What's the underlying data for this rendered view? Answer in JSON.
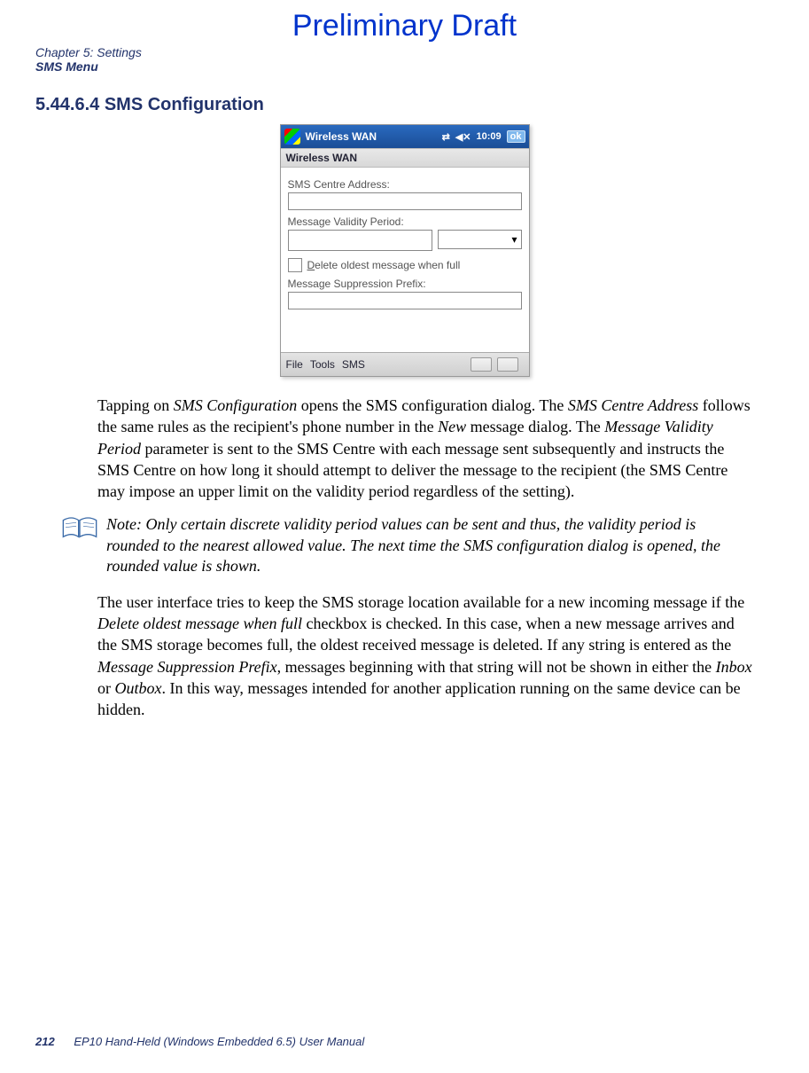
{
  "header": {
    "draft": "Preliminary Draft",
    "chapter": "Chapter 5: Settings",
    "section": "SMS Menu"
  },
  "heading": "5.44.6.4 SMS Configuration",
  "screenshot": {
    "titlebar": {
      "app": "Wireless WAN",
      "conn_icon": "connectivity-icon",
      "vol_icon": "volume-icon",
      "time": "10:09",
      "ok": "ok"
    },
    "subheader": "Wireless WAN",
    "labels": {
      "sms_centre": "SMS Centre Address:",
      "validity": "Message Validity Period:",
      "delete_prefix": "D",
      "delete_rest": "elete oldest message when full",
      "suppression": "Message Suppression Prefix:"
    },
    "menubar": {
      "file": "File",
      "tools": "Tools",
      "sms": "SMS"
    }
  },
  "para1": {
    "t1": "Tapping on ",
    "i1": "SMS Configuration",
    "t2": " opens the SMS configuration dialog. The ",
    "i2": "SMS Centre Address",
    "t3": " follows the same rules as the recipient's phone number in the ",
    "i3": "New",
    "t4": " message dialog. The ",
    "i4": "Message Validity Period",
    "t5": " parameter is sent to the SMS Centre with each message sent subsequently and instructs the SMS Centre on how long it should attempt to deliver the message to the recipient (the SMS Centre may impose an upper limit on the validity period regardless of the setting)."
  },
  "note": {
    "label": "Note:",
    "text": "Only certain discrete validity period values can be sent and thus, the validity period is rounded to the nearest allowed value. The next time the SMS configuration dialog is opened, the rounded value is shown."
  },
  "para2": {
    "t1": "The user interface tries to keep the SMS storage location available for a new incoming message if the ",
    "i1": "Delete oldest message when full",
    "t2": " checkbox is checked. In this case, when a new message arrives and the SMS storage becomes full, the oldest received message is deleted. If any string is entered as the ",
    "i2": "Message Suppression Prefix",
    "t3": ", messages beginning with that string will not be shown in either the ",
    "i3": "Inbox",
    "t4": " or ",
    "i4": "Outbox",
    "t5": ". In this way, messages intended for another application running on the same device can be hidden."
  },
  "footer": {
    "page": "212",
    "manual": "EP10 Hand-Held (Windows Embedded 6.5) User Manual"
  }
}
